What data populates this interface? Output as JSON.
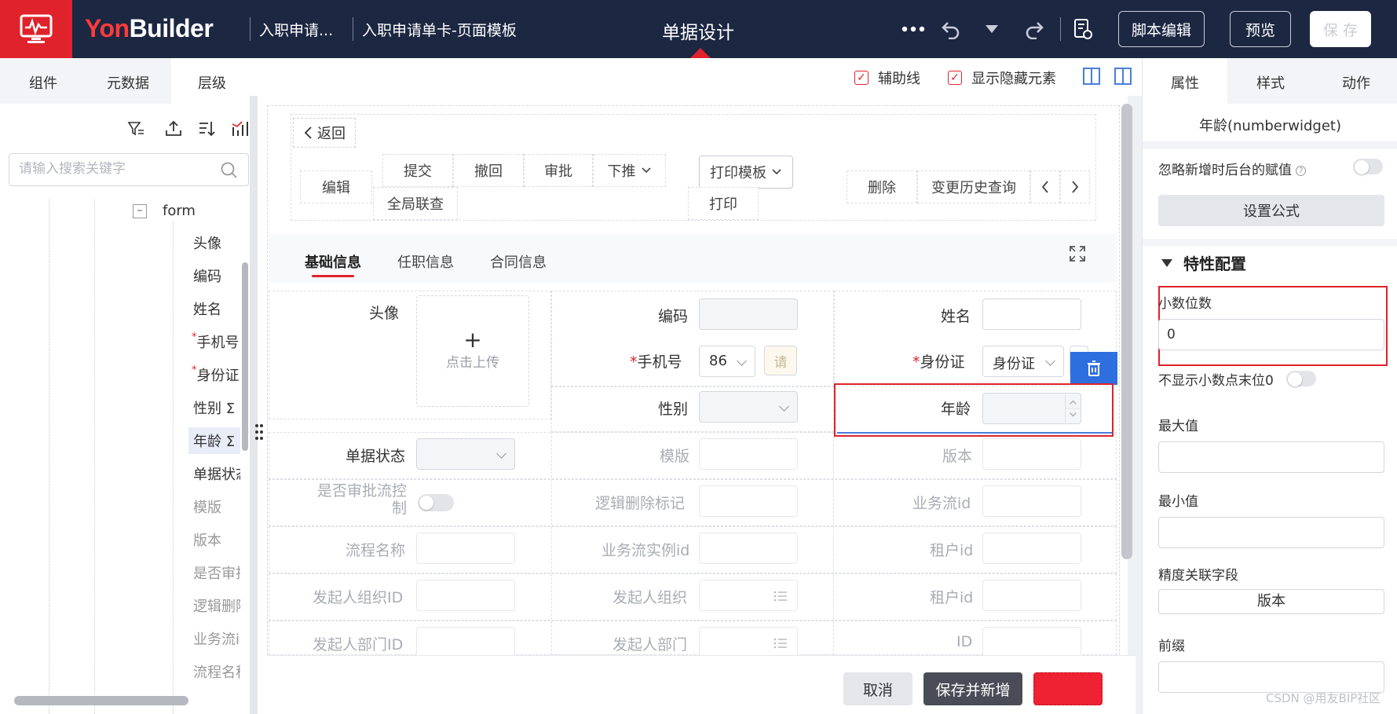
{
  "header": {
    "brand_prefix": "Yon",
    "brand_suffix": "Builder",
    "breadcrumb_1": "入职申请...",
    "breadcrumb_2": "入职申请单卡-页面模板",
    "center_title": "单据设计",
    "btn_script": "脚本编辑",
    "btn_preview": "预览",
    "btn_save": "保 存"
  },
  "left": {
    "tabs": [
      "组件",
      "元数据",
      "层级"
    ],
    "active_tab": "层级",
    "search_placeholder": "请输入搜索关键字",
    "tree_root": "form",
    "tree": [
      {
        "label": "头像"
      },
      {
        "label": "编码"
      },
      {
        "label": "姓名"
      },
      {
        "label": "手机号",
        "required": true
      },
      {
        "label": "身份证",
        "required": true
      },
      {
        "label": "性别 Σ"
      },
      {
        "label": "年龄 Σ",
        "selected": true
      },
      {
        "label": "单据状态"
      },
      {
        "label": "模版",
        "dim": true
      },
      {
        "label": "版本",
        "dim": true
      },
      {
        "label": "是否审批",
        "dim": true
      },
      {
        "label": "逻辑删除",
        "dim": true
      },
      {
        "label": "业务流id",
        "dim": true
      },
      {
        "label": "流程名称",
        "dim": true
      }
    ]
  },
  "canvas_top": {
    "aux_lines": "辅助线",
    "show_hidden": "显示隐藏元素"
  },
  "form": {
    "back": "返回",
    "actions": {
      "edit": "编辑",
      "submit": "提交",
      "withdraw": "撤回",
      "approve": "审批",
      "push_down": "下推",
      "global_link": "全局联查",
      "print_template": "打印模板",
      "print": "打印",
      "delete": "删除",
      "history": "变更历史查询"
    },
    "tabs": [
      "基础信息",
      "任职信息",
      "合同信息"
    ],
    "active_tab": "基础信息",
    "fields": {
      "avatar": "头像",
      "upload_plus": "+",
      "upload_text": "点击上传",
      "code": "编码",
      "name": "姓名",
      "phone": "手机号",
      "phone_prefix": "86",
      "phone_btn": "请",
      "idcard": "身份证",
      "idcard_select": "身份证",
      "gender": "性别",
      "age": "年龄",
      "doc_status": "单据状态",
      "template": "模版",
      "version": "版本",
      "need_approval": "是否审批流控制",
      "logic_delete": "逻辑删除标记",
      "biz_flow_id": "业务流id",
      "flow_name": "流程名称",
      "biz_flow_instance": "业务流实例id",
      "tenant_id": "租户id",
      "initiator_org_id": "发起人组织ID",
      "initiator_org": "发起人组织",
      "tenant_id_2": "租户id",
      "initiator_dept_id": "发起人部门ID",
      "initiator_dept": "发起人部门",
      "id": "ID"
    },
    "footer": {
      "cancel": "取消",
      "save_new": "保存并新增"
    }
  },
  "right": {
    "tabs": [
      "属性",
      "样式",
      "动作"
    ],
    "active_tab": "属性",
    "title": "年龄(numberwidget)",
    "ignore_default": "忽略新增时后台的赋值",
    "ignore_default_help": "?",
    "set_formula": "设置公式",
    "section": "特性配置",
    "decimal_places_label": "小数位数",
    "decimal_places_value": "0",
    "hide_trailing_zero": "不显示小数点末位0",
    "max_label": "最大值",
    "min_label": "最小值",
    "precision_field_label": "精度关联字段",
    "precision_field_value": "版本",
    "prefix_label": "前缀"
  },
  "watermark": "CSDN @用友BIP社区",
  "colors": {
    "brand_red": "#e0222b",
    "topbar": "#1c2742",
    "accent_blue": "#2e6fe0"
  }
}
